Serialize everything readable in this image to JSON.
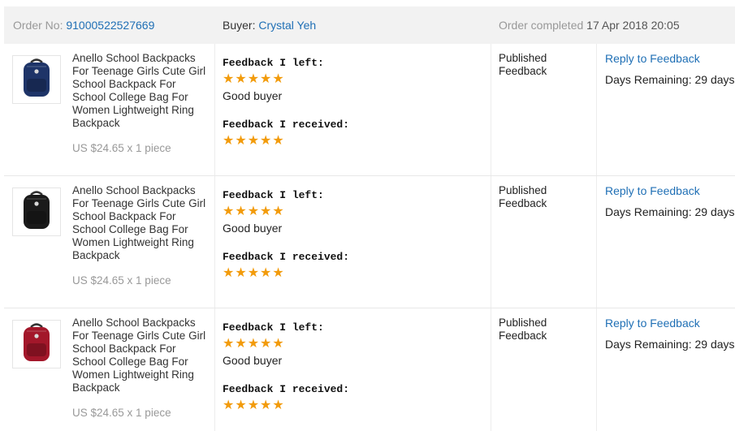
{
  "header": {
    "order_label": "Order No:",
    "order_number": "91000522527669",
    "buyer_label": "Buyer:",
    "buyer_name": "Crystal Yeh",
    "status_label": "Order completed",
    "status_date": "17 Apr 2018 20:05"
  },
  "items": [
    {
      "title": "Anello School Backpacks For Teenage Girls Cute Girl School Backpack For School College Bag For Women Lightweight Ring Backpack",
      "price": "US $24.65 x 1 piece",
      "image_color": "#1e3468",
      "feedback_left_label": "Feedback I left:",
      "feedback_left_stars": 5,
      "feedback_left_comment": "Good buyer",
      "feedback_received_label": "Feedback I received:",
      "feedback_received_stars": 5,
      "status": "Published Feedback",
      "reply_link": "Reply to Feedback",
      "days_remaining": "Days Remaining: 29 days"
    },
    {
      "title": "Anello School Backpacks For Teenage Girls Cute Girl School Backpack For School College Bag For Women Lightweight Ring Backpack",
      "price": "US $24.65 x 1 piece",
      "image_color": "#1a1a1a",
      "feedback_left_label": "Feedback I left:",
      "feedback_left_stars": 5,
      "feedback_left_comment": "Good buyer",
      "feedback_received_label": "Feedback I received:",
      "feedback_received_stars": 5,
      "status": "Published Feedback",
      "reply_link": "Reply to Feedback",
      "days_remaining": "Days Remaining: 29 days"
    },
    {
      "title": "Anello School Backpacks For Teenage Girls Cute Girl School Backpack For School College Bag For Women Lightweight Ring Backpack",
      "price": "US $24.65 x 1 piece",
      "image_color": "#a3172a",
      "feedback_left_label": "Feedback I left:",
      "feedback_left_stars": 5,
      "feedback_left_comment": "Good buyer",
      "feedback_received_label": "Feedback I received:",
      "feedback_received_stars": 5,
      "status": "Published Feedback",
      "reply_link": "Reply to Feedback",
      "days_remaining": "Days Remaining: 29 days"
    }
  ],
  "colors": {
    "link": "#1f6fb5",
    "star": "#f29b0b",
    "header_bg": "#f2f2f2"
  }
}
